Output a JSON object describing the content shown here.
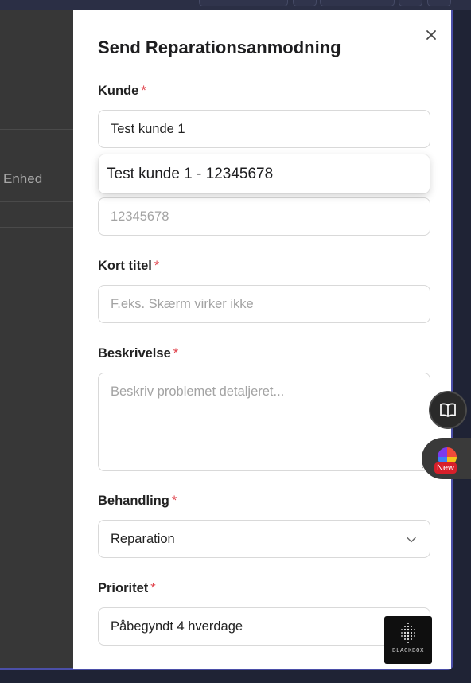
{
  "background": {
    "column_label": "Enhed"
  },
  "dialog": {
    "title": "Send Reparationsanmodning",
    "close_icon": "close-icon",
    "fields": {
      "customer": {
        "label": "Kunde",
        "required_mark": "*",
        "value": "Test kunde 1"
      },
      "customer_suggestion": "Test kunde 1 - 12345678",
      "phone": {
        "placeholder": "12345678"
      },
      "short_title": {
        "label": "Kort titel",
        "required_mark": "*",
        "placeholder": "F.eks. Skærm virker ikke"
      },
      "description": {
        "label": "Beskrivelse",
        "required_mark": "*",
        "placeholder": "Beskriv problemet detaljeret..."
      },
      "handling": {
        "label": "Behandling",
        "required_mark": "*",
        "selected": "Reparation"
      },
      "priority": {
        "label": "Prioritet",
        "required_mark": "*",
        "selected": "Påbegyndt 4 hverdage"
      }
    }
  },
  "widgets": {
    "reader_icon": "open-book-icon",
    "extension_badge": "New",
    "blackbox_label": "BLACKBOX"
  },
  "colors": {
    "accent_frame": "#4b4fa8",
    "required": "#e0414a",
    "backdrop": "#373737"
  }
}
